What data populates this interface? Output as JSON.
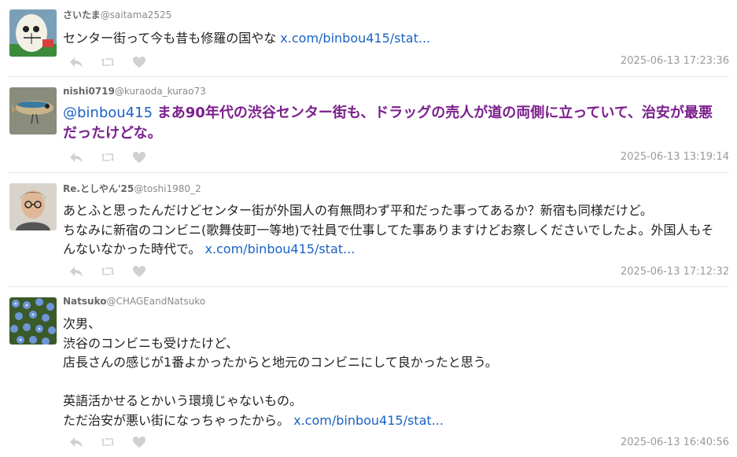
{
  "tweets": [
    {
      "name": "さいたま",
      "handle": "@saitama2525",
      "text": "センター街って今も昔も修羅の国やな ",
      "link": "x.com/binbou415/stat...",
      "timestamp": "2025-06-13 17:23:36",
      "avatar": "doraemon-avatar"
    },
    {
      "name": "nishi0719",
      "handle": "@kuraoda_kurao73",
      "mention": "@binbou415 ",
      "text": "まあ90年代の渋谷センター街も、ドラッグの売人が道の両側に立っていて、治安が最悪だったけどな。",
      "timestamp": "2025-06-13 13:19:14",
      "avatar": "fishing-lure-avatar"
    },
    {
      "name": "Re.としやん'25",
      "handle": "@toshi1980_2",
      "text": "あとふと思ったんだけどセンター街が外国人の有無問わず平和だった事ってあるか？新宿も同様だけど。\nちなみに新宿のコンビニ(歌舞伎町一等地)で社員で仕事してた事ありますけどお察しくださいでしたよ。外国人もそんないなかった時代で。 ",
      "link": "x.com/binbou415/stat...",
      "timestamp": "2025-06-13 17:12:32",
      "avatar": "man-glasses-avatar"
    },
    {
      "name": "Natsuko",
      "handle": "@CHAGEandNatsuko",
      "text": "次男、\n渋谷のコンビニも受けたけど、\n店長さんの感じが1番よかったからと地元のコンビニにして良かったと思う。\n\n英語活かせるとかいう環境じゃないもの。\nただ治安が悪い街になっちゃったから。 ",
      "link": "x.com/binbou415/stat...",
      "timestamp": "2025-06-13 16:40:56",
      "avatar": "blue-flowers-avatar"
    }
  ],
  "icons": {
    "reply": "reply-icon",
    "retweet": "retweet-icon",
    "like": "heart-icon"
  },
  "colors": {
    "link": "#1a62c4",
    "highlight_text": "#7a1f8c",
    "icon": "#d0d0d0"
  }
}
